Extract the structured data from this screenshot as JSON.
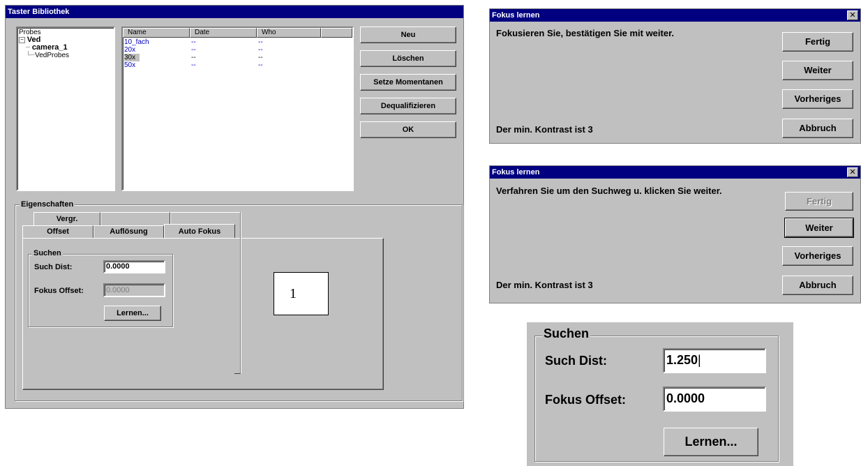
{
  "library": {
    "title": "Taster Bibliothek",
    "tree": {
      "root": "Probes",
      "node": "Ved",
      "children": [
        "camera_1",
        "VedProbes"
      ]
    },
    "columns": [
      "Name",
      "Date",
      "Who"
    ],
    "rows": [
      {
        "name": "10_fach",
        "date": "--",
        "who": "--"
      },
      {
        "name": "20x",
        "date": "--",
        "who": "--"
      },
      {
        "name": "30x",
        "date": "--",
        "who": "--"
      },
      {
        "name": "50x",
        "date": "--",
        "who": "--"
      }
    ],
    "selected_row": "30x",
    "buttons": {
      "new": "Neu",
      "delete": "Löschen",
      "set_current": "Setze Momentanen",
      "dequalify": "Dequalifizieren",
      "ok": "OK"
    },
    "properties_label": "Eigenschaften",
    "tabs_row1": [
      "Vergr.",
      "",
      ""
    ],
    "tabs_row2": [
      "Offset",
      "Auflösung",
      "Auto Fokus"
    ],
    "active_tab": "Auto Fokus",
    "search_group": "Suchen",
    "search_dist_label": "Such Dist:",
    "search_dist_value": "0.0000",
    "focus_offset_label": "Fokus Offset:",
    "focus_offset_value": "0.0000",
    "learn_button": "Lernen...",
    "callout": "1"
  },
  "focus_dialog_1": {
    "title": "Fokus lernen",
    "message": "Fokusieren Sie, bestätigen Sie mit weiter.",
    "status": "Der min. Kontrast ist 3",
    "buttons": {
      "done": "Fertig",
      "next": "Weiter",
      "previous": "Vorheriges",
      "cancel": "Abbruch"
    }
  },
  "focus_dialog_2": {
    "title": "Fokus lernen",
    "message": "Verfahren Sie um den Suchweg u. klicken Sie weiter.",
    "status": "Der min. Kontrast ist 3",
    "buttons": {
      "done": "Fertig",
      "next": "Weiter",
      "previous": "Vorheriges",
      "cancel": "Abbruch"
    }
  },
  "zoom_panel": {
    "group": "Suchen",
    "search_dist_label": "Such Dist:",
    "search_dist_value": "1.250",
    "focus_offset_label": "Fokus Offset:",
    "focus_offset_value": "0.0000",
    "learn_button": "Lernen..."
  }
}
